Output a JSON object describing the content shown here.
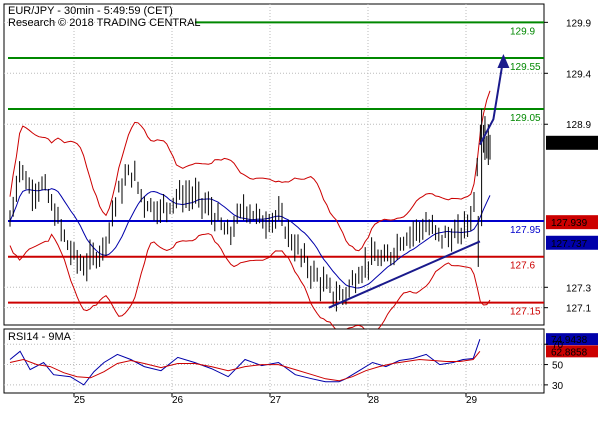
{
  "header": {
    "line1": "EUR/JPY - 30min - 5:49:59 (CET)",
    "line2": "Research © 2018 TRADING CENTRAL"
  },
  "colors": {
    "price": "#000000",
    "bollinger": "#cc0000",
    "moving_average": "#0000aa",
    "support": "#cc0000",
    "pivot": "#0000cc",
    "resistance": "#008800",
    "trendline": "#1a1a8c",
    "arrow": "#1a1a8c",
    "rsi_line": "#0000aa",
    "rsi_signal": "#cc0000"
  },
  "chart_data": [
    {
      "type": "candlestick",
      "ylim": [
        126.93,
        130.08
      ],
      "x_tick_labels": [
        "25",
        "26",
        "27",
        "28",
        "29"
      ],
      "y_tick_labels": [
        "129.9",
        "129.4",
        "128.9",
        "127.3",
        "127.1"
      ],
      "current_price": "128.718",
      "levels": [
        {
          "label": "129.9",
          "value": 129.9,
          "kind": "resistance"
        },
        {
          "label": "129.55",
          "value": 129.55,
          "kind": "resistance"
        },
        {
          "label": "129.05",
          "value": 129.05,
          "kind": "resistance"
        },
        {
          "label": "127.95",
          "value": 127.95,
          "kind": "pivot"
        },
        {
          "label": "127.6",
          "value": 127.6,
          "kind": "support"
        },
        {
          "label": "127.15",
          "value": 127.15,
          "kind": "support"
        }
      ],
      "price_badges": [
        {
          "label": "127.939",
          "value": 127.939,
          "color": "#cc0000"
        },
        {
          "label": "127.737",
          "value": 127.737,
          "color": "#0000aa"
        }
      ],
      "close_path": [
        [
          0,
          127.95
        ],
        [
          0.03,
          128.5
        ],
        [
          0.06,
          128.25
        ],
        [
          0.1,
          128.3
        ],
        [
          0.13,
          128.05
        ],
        [
          0.18,
          127.65
        ],
        [
          0.22,
          127.5
        ],
        [
          0.25,
          127.6
        ],
        [
          0.28,
          127.7
        ],
        [
          0.32,
          128.2
        ],
        [
          0.36,
          128.45
        ],
        [
          0.4,
          128.15
        ],
        [
          0.45,
          128.05
        ],
        [
          0.5,
          128.2
        ],
        [
          0.55,
          128.2
        ],
        [
          0.6,
          128.05
        ],
        [
          0.65,
          127.8
        ],
        [
          0.7,
          128.1
        ],
        [
          0.75,
          127.95
        ],
        [
          0.8,
          128.0
        ],
        [
          0.85,
          127.7
        ],
        [
          0.9,
          127.45
        ],
        [
          0.94,
          127.3
        ],
        [
          0.98,
          127.2
        ],
        [
          1.0,
          127.25
        ],
        [
          1.04,
          127.45
        ],
        [
          1.08,
          127.6
        ],
        [
          1.12,
          127.55
        ],
        [
          1.16,
          127.75
        ],
        [
          1.2,
          127.85
        ],
        [
          1.24,
          127.9
        ],
        [
          1.28,
          127.8
        ],
        [
          1.32,
          127.8
        ],
        [
          1.35,
          127.85
        ],
        [
          1.38,
          128.05
        ],
        [
          1.4,
          128.85
        ],
        [
          1.43,
          128.7
        ]
      ],
      "projection": [
        [
          1.4,
          128.7
        ],
        [
          1.44,
          128.95
        ],
        [
          1.47,
          129.55
        ]
      ],
      "trendline": [
        [
          0.95,
          127.1
        ],
        [
          1.4,
          127.75
        ]
      ]
    },
    {
      "type": "line",
      "title": "RSI14 - 9MA",
      "ylim": [
        22,
        85
      ],
      "y_tick_labels": [
        "70",
        "50",
        "30"
      ],
      "x_tick_labels": [
        "25",
        "26",
        "27",
        "28",
        "29"
      ],
      "series": [
        {
          "name": "RSI14",
          "value_label": "74.9438",
          "values": [
            [
              0,
              55
            ],
            [
              0.03,
              63
            ],
            [
              0.06,
              45
            ],
            [
              0.1,
              52
            ],
            [
              0.13,
              40
            ],
            [
              0.18,
              38
            ],
            [
              0.22,
              30
            ],
            [
              0.25,
              43
            ],
            [
              0.28,
              52
            ],
            [
              0.32,
              60
            ],
            [
              0.36,
              55
            ],
            [
              0.4,
              48
            ],
            [
              0.45,
              44
            ],
            [
              0.5,
              57
            ],
            [
              0.55,
              52
            ],
            [
              0.6,
              46
            ],
            [
              0.65,
              38
            ],
            [
              0.7,
              55
            ],
            [
              0.75,
              49
            ],
            [
              0.8,
              52
            ],
            [
              0.85,
              40
            ],
            [
              0.9,
              36
            ],
            [
              0.94,
              33
            ],
            [
              0.98,
              33
            ],
            [
              1.0,
              36
            ],
            [
              1.04,
              44
            ],
            [
              1.08,
              52
            ],
            [
              1.12,
              48
            ],
            [
              1.16,
              54
            ],
            [
              1.2,
              56
            ],
            [
              1.24,
              60
            ],
            [
              1.28,
              50
            ],
            [
              1.32,
              52
            ],
            [
              1.35,
              55
            ],
            [
              1.38,
              56
            ],
            [
              1.4,
              75
            ]
          ]
        },
        {
          "name": "9MA",
          "value_label": "62.8858",
          "values": [
            [
              0,
              52
            ],
            [
              0.04,
              55
            ],
            [
              0.08,
              50
            ],
            [
              0.12,
              48
            ],
            [
              0.16,
              42
            ],
            [
              0.2,
              38
            ],
            [
              0.24,
              37
            ],
            [
              0.28,
              43
            ],
            [
              0.32,
              51
            ],
            [
              0.36,
              54
            ],
            [
              0.4,
              51
            ],
            [
              0.45,
              47
            ],
            [
              0.5,
              51
            ],
            [
              0.55,
              51
            ],
            [
              0.6,
              48
            ],
            [
              0.65,
              44
            ],
            [
              0.7,
              48
            ],
            [
              0.75,
              50
            ],
            [
              0.8,
              50
            ],
            [
              0.85,
              45
            ],
            [
              0.9,
              40
            ],
            [
              0.94,
              36
            ],
            [
              0.98,
              34
            ],
            [
              1.02,
              38
            ],
            [
              1.06,
              44
            ],
            [
              1.1,
              48
            ],
            [
              1.14,
              51
            ],
            [
              1.18,
              53
            ],
            [
              1.22,
              55
            ],
            [
              1.26,
              54
            ],
            [
              1.3,
              53
            ],
            [
              1.34,
              53
            ],
            [
              1.38,
              55
            ],
            [
              1.4,
              63
            ]
          ]
        }
      ]
    }
  ]
}
